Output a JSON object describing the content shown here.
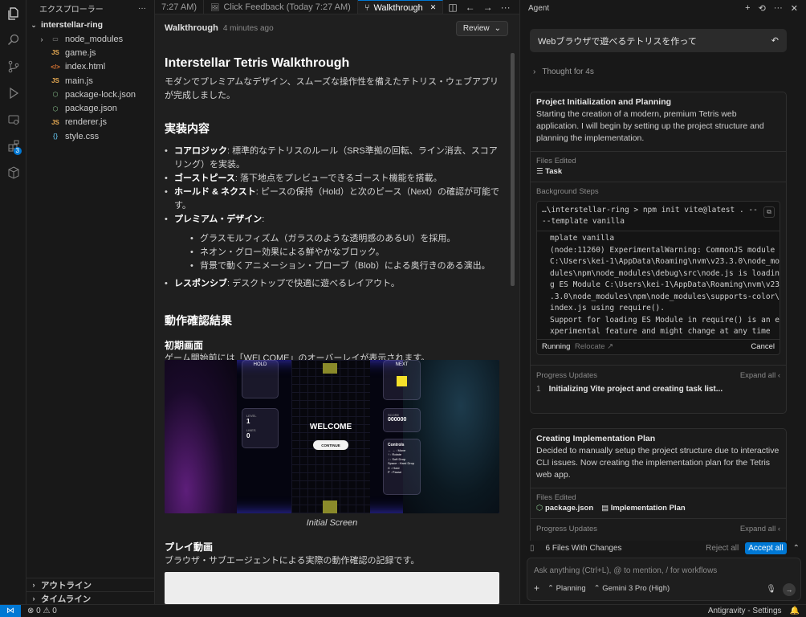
{
  "explorer": {
    "title": "エクスプローラー",
    "more": "···",
    "root": "interstellar-ring",
    "items": [
      {
        "label": "node_modules",
        "icon": "folder-icon",
        "glyph": "▭",
        "color": "#8c8c8c",
        "chev": "›"
      },
      {
        "label": "game.js",
        "icon": "js-icon",
        "glyph": "JS",
        "color": "#e8ab53",
        "chev": ""
      },
      {
        "label": "index.html",
        "icon": "html-icon",
        "glyph": "</>",
        "color": "#e37933",
        "chev": ""
      },
      {
        "label": "main.js",
        "icon": "js-icon",
        "glyph": "JS",
        "color": "#e8ab53",
        "chev": ""
      },
      {
        "label": "package-lock.json",
        "icon": "json-icon",
        "glyph": "⬡",
        "color": "#8dc891",
        "chev": ""
      },
      {
        "label": "package.json",
        "icon": "json-icon",
        "glyph": "⬡",
        "color": "#8dc891",
        "chev": ""
      },
      {
        "label": "renderer.js",
        "icon": "js-icon",
        "glyph": "JS",
        "color": "#e8ab53",
        "chev": ""
      },
      {
        "label": "style.css",
        "icon": "css-icon",
        "glyph": "{}",
        "color": "#519aba",
        "chev": ""
      }
    ],
    "outline": "アウトライン",
    "timeline": "タイムライン"
  },
  "activity": {
    "badge": "3"
  },
  "tabs": [
    {
      "label": "7:27 AM)",
      "icon": ""
    },
    {
      "label": "Click Feedback (Today 7:27 AM)",
      "icon": "🖼"
    },
    {
      "label": "Walkthrough",
      "icon": "⑂",
      "close": "✕"
    }
  ],
  "editor_header": {
    "title": "Walkthrough",
    "ago": "4 minutes ago",
    "review": "Review",
    "review_chev": "⌄"
  },
  "doc": {
    "title": "Interstellar Tetris Walkthrough",
    "intro": "モダンでプレミアムなデザイン、スムーズな操作性を備えたテトリス・ウェブアプリが完成しました。",
    "impl_heading": "実装内容",
    "features": [
      {
        "name": "コアロジック",
        "text": ": 標準的なテトリスのルール（SRS準拠の回転、ライン消去、スコアリング）を実装。"
      },
      {
        "name": "ゴーストピース",
        "text": ": 落下地点をプレビューできるゴースト機能を搭載。"
      },
      {
        "name": "ホールド & ネクスト",
        "text": ": ピースの保持（Hold）と次のピース（Next）の確認が可能です。"
      },
      {
        "name": "プレミアム・デザイン",
        "text": ":"
      }
    ],
    "design_sub": [
      "グラスモルフィズム（ガラスのような透明感のあるUI）を採用。",
      "ネオン・グロー効果による鮮やかなブロック。",
      "背景で動くアニメーション・ブローブ（Blob）による奥行きのある演出。"
    ],
    "responsive": {
      "name": "レスポンシブ",
      "text": ": デスクトップで快適に遊べるレイアウト。"
    },
    "verify_heading": "動作確認結果",
    "initial_heading": "初期画面",
    "initial_text": "ゲーム開始前には「WELCOME」のオーバーレイが表示されます。",
    "caption": "Initial Screen",
    "play_heading": "プレイ動画",
    "play_text": "ブラウザ・サブエージェントによる実際の動作確認の記録です。"
  },
  "game": {
    "hold": "HOLD",
    "next": "NEXT",
    "level_label": "LEVEL",
    "level": "1",
    "lines_label": "LINES",
    "lines": "0",
    "score_label": "SCORE",
    "score": "000000",
    "welcome": "WELCOME",
    "continue": "CONTINUE",
    "controls_title": "Controls",
    "controls": [
      "← → : Move",
      "↑ : Rotate",
      "↓ : Soft Drop",
      "Space : Hard Drop",
      "C : Hold",
      "P : Pause"
    ],
    "next_color": "#f5e02a",
    "hold_color": "#8a8a2a"
  },
  "agent": {
    "title": "Agent",
    "prompt": "Webブラウザで遊べるテトリスを作って",
    "undo": "↶",
    "thought": "Thought for 4s",
    "card1": {
      "title": "Project Initialization and Planning",
      "desc": "Starting the creation of a modern, premium Tetris web application. I will begin by setting up the project structure and planning the implementation.",
      "files_label": "Files Edited",
      "file": "Task",
      "bg_label": "Background Steps",
      "cmd": "…\\interstellar-ring > npm init vite@latest . --\n--template vanilla",
      "output": "mplate vanilla\n(node:11260) ExperimentalWarning: CommonJS module\nC:\\Users\\kei-1\\AppData\\Roaming\\nvm\\v23.3.0\\node_mo\ndules\\npm\\node_modules\\debug\\src\\node.js is loadin\ng ES Module C:\\Users\\kei-1\\AppData\\Roaming\\nvm\\v23\n.3.0\\node_modules\\npm\\node_modules\\supports-color\\\nindex.js using require().\nSupport for loading ES Module in require() is an e\nxperimental feature and might change at any time\n(Use `node --trace-warnings ...` to show where the",
      "running": "Running",
      "relocate": "Relocate",
      "cancel": "Cancel",
      "pu_label": "Progress Updates",
      "expand": "Expand all",
      "pu_num": "1",
      "pu_text": "Initializing Vite project and creating task list..."
    },
    "card2": {
      "title": "Creating Implementation Plan",
      "desc": "Decided to manually setup the project structure due to interactive CLI issues. Now creating the implementation plan for the Tetris web app.",
      "files_label": "Files Edited",
      "file1": "package.json",
      "file2": "Implementation Plan",
      "pu_label": "Progress Updates",
      "expand": "Expand all"
    },
    "changes": {
      "count": "6 Files With Changes",
      "reject": "Reject all",
      "accept": "Accept all"
    },
    "input": {
      "placeholder": "Ask anything (Ctrl+L), @ to mention, / for workflows",
      "mode": "Planning",
      "model": "Gemini 3 Pro (High)"
    }
  },
  "status": {
    "problems": "⊗ 0 ⚠ 0",
    "right": "Antigravity - Settings"
  }
}
